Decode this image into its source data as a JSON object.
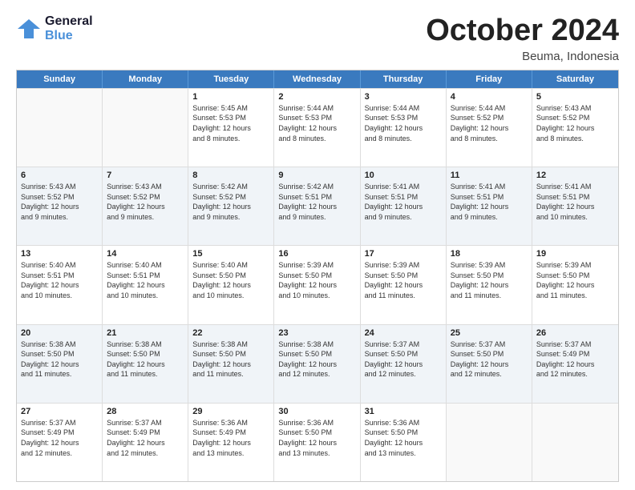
{
  "logo": {
    "general": "General",
    "blue": "Blue"
  },
  "header": {
    "month": "October 2024",
    "location": "Beuma, Indonesia"
  },
  "weekdays": [
    "Sunday",
    "Monday",
    "Tuesday",
    "Wednesday",
    "Thursday",
    "Friday",
    "Saturday"
  ],
  "rows": [
    [
      {
        "day": "",
        "info": "",
        "empty": true
      },
      {
        "day": "",
        "info": "",
        "empty": true
      },
      {
        "day": "1",
        "info": "Sunrise: 5:45 AM\nSunset: 5:53 PM\nDaylight: 12 hours\nand 8 minutes."
      },
      {
        "day": "2",
        "info": "Sunrise: 5:44 AM\nSunset: 5:53 PM\nDaylight: 12 hours\nand 8 minutes."
      },
      {
        "day": "3",
        "info": "Sunrise: 5:44 AM\nSunset: 5:53 PM\nDaylight: 12 hours\nand 8 minutes."
      },
      {
        "day": "4",
        "info": "Sunrise: 5:44 AM\nSunset: 5:52 PM\nDaylight: 12 hours\nand 8 minutes."
      },
      {
        "day": "5",
        "info": "Sunrise: 5:43 AM\nSunset: 5:52 PM\nDaylight: 12 hours\nand 8 minutes."
      }
    ],
    [
      {
        "day": "6",
        "info": "Sunrise: 5:43 AM\nSunset: 5:52 PM\nDaylight: 12 hours\nand 9 minutes."
      },
      {
        "day": "7",
        "info": "Sunrise: 5:43 AM\nSunset: 5:52 PM\nDaylight: 12 hours\nand 9 minutes."
      },
      {
        "day": "8",
        "info": "Sunrise: 5:42 AM\nSunset: 5:52 PM\nDaylight: 12 hours\nand 9 minutes."
      },
      {
        "day": "9",
        "info": "Sunrise: 5:42 AM\nSunset: 5:51 PM\nDaylight: 12 hours\nand 9 minutes."
      },
      {
        "day": "10",
        "info": "Sunrise: 5:41 AM\nSunset: 5:51 PM\nDaylight: 12 hours\nand 9 minutes."
      },
      {
        "day": "11",
        "info": "Sunrise: 5:41 AM\nSunset: 5:51 PM\nDaylight: 12 hours\nand 9 minutes."
      },
      {
        "day": "12",
        "info": "Sunrise: 5:41 AM\nSunset: 5:51 PM\nDaylight: 12 hours\nand 10 minutes."
      }
    ],
    [
      {
        "day": "13",
        "info": "Sunrise: 5:40 AM\nSunset: 5:51 PM\nDaylight: 12 hours\nand 10 minutes."
      },
      {
        "day": "14",
        "info": "Sunrise: 5:40 AM\nSunset: 5:51 PM\nDaylight: 12 hours\nand 10 minutes."
      },
      {
        "day": "15",
        "info": "Sunrise: 5:40 AM\nSunset: 5:50 PM\nDaylight: 12 hours\nand 10 minutes."
      },
      {
        "day": "16",
        "info": "Sunrise: 5:39 AM\nSunset: 5:50 PM\nDaylight: 12 hours\nand 10 minutes."
      },
      {
        "day": "17",
        "info": "Sunrise: 5:39 AM\nSunset: 5:50 PM\nDaylight: 12 hours\nand 11 minutes."
      },
      {
        "day": "18",
        "info": "Sunrise: 5:39 AM\nSunset: 5:50 PM\nDaylight: 12 hours\nand 11 minutes."
      },
      {
        "day": "19",
        "info": "Sunrise: 5:39 AM\nSunset: 5:50 PM\nDaylight: 12 hours\nand 11 minutes."
      }
    ],
    [
      {
        "day": "20",
        "info": "Sunrise: 5:38 AM\nSunset: 5:50 PM\nDaylight: 12 hours\nand 11 minutes."
      },
      {
        "day": "21",
        "info": "Sunrise: 5:38 AM\nSunset: 5:50 PM\nDaylight: 12 hours\nand 11 minutes."
      },
      {
        "day": "22",
        "info": "Sunrise: 5:38 AM\nSunset: 5:50 PM\nDaylight: 12 hours\nand 11 minutes."
      },
      {
        "day": "23",
        "info": "Sunrise: 5:38 AM\nSunset: 5:50 PM\nDaylight: 12 hours\nand 12 minutes."
      },
      {
        "day": "24",
        "info": "Sunrise: 5:37 AM\nSunset: 5:50 PM\nDaylight: 12 hours\nand 12 minutes."
      },
      {
        "day": "25",
        "info": "Sunrise: 5:37 AM\nSunset: 5:50 PM\nDaylight: 12 hours\nand 12 minutes."
      },
      {
        "day": "26",
        "info": "Sunrise: 5:37 AM\nSunset: 5:49 PM\nDaylight: 12 hours\nand 12 minutes."
      }
    ],
    [
      {
        "day": "27",
        "info": "Sunrise: 5:37 AM\nSunset: 5:49 PM\nDaylight: 12 hours\nand 12 minutes."
      },
      {
        "day": "28",
        "info": "Sunrise: 5:37 AM\nSunset: 5:49 PM\nDaylight: 12 hours\nand 12 minutes."
      },
      {
        "day": "29",
        "info": "Sunrise: 5:36 AM\nSunset: 5:49 PM\nDaylight: 12 hours\nand 13 minutes."
      },
      {
        "day": "30",
        "info": "Sunrise: 5:36 AM\nSunset: 5:50 PM\nDaylight: 12 hours\nand 13 minutes."
      },
      {
        "day": "31",
        "info": "Sunrise: 5:36 AM\nSunset: 5:50 PM\nDaylight: 12 hours\nand 13 minutes."
      },
      {
        "day": "",
        "info": "",
        "empty": true
      },
      {
        "day": "",
        "info": "",
        "empty": true
      }
    ]
  ]
}
